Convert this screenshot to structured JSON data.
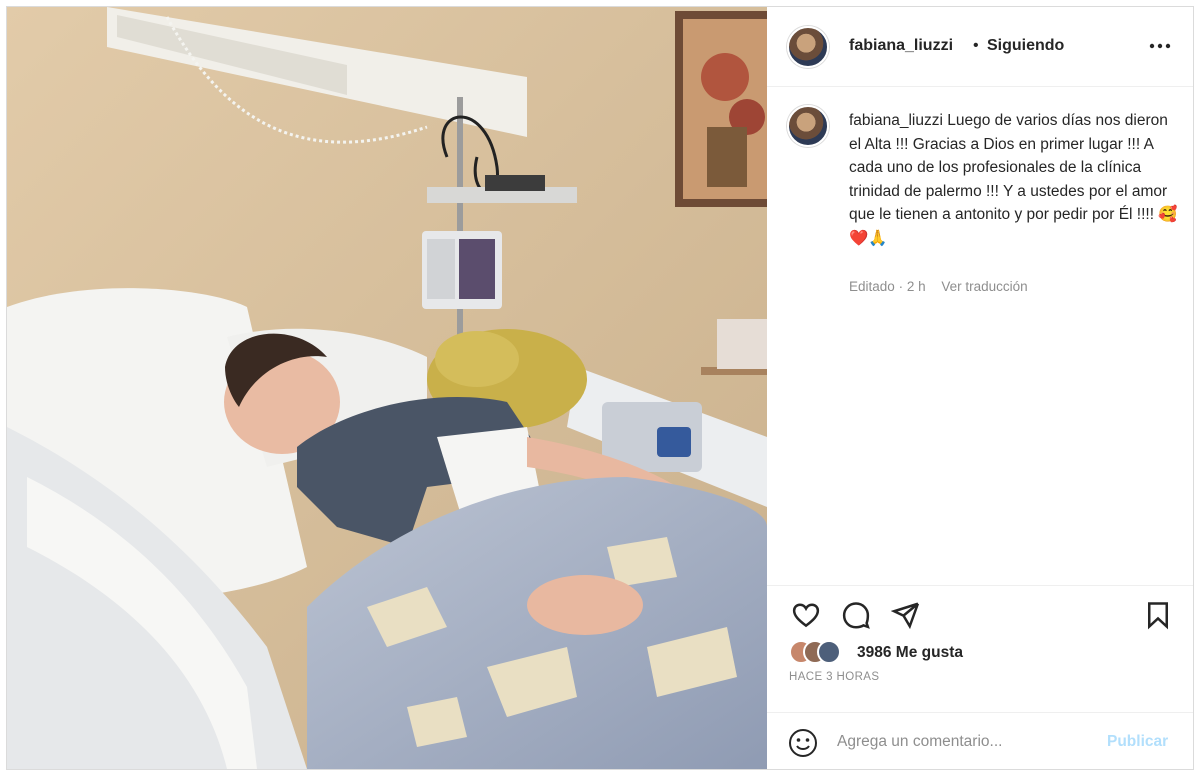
{
  "post": {
    "header": {
      "username": "fabiana_liuzzi",
      "separator": "•",
      "follow_state": "Siguiendo",
      "more_icon": "more-horizontal-icon"
    },
    "photo": {
      "kind": "photograph",
      "palette": {
        "wall": "#d9c2a0",
        "pillow": "#f3f3f1",
        "shirt": "#4a5566",
        "blanket": "#a9b4c9",
        "skin": "#e8b8a0",
        "hair": "#3a2a22",
        "bear": "#c9b04a"
      }
    },
    "caption": {
      "username": "fabiana_liuzzi",
      "text": "Luego de varios días nos dieron el Alta !!! Gracias a Dios en primer lugar !!! A cada uno de los profesionales de la clínica trinidad de palermo !!! Y a ustedes por el amor que le tienen a antonito y por pedir por Él !!!! 🥰❤️🙏",
      "edited_label": "Editado",
      "age": "2 h",
      "translate_label": "Ver traducción"
    },
    "actions": {
      "like_icon": "heart-icon",
      "comment_icon": "comment-icon",
      "share_icon": "paper-plane-icon",
      "save_icon": "bookmark-icon"
    },
    "likes": {
      "count": "3986",
      "label": "Me gusta"
    },
    "timestamp": "HACE 3 HORAS",
    "comment_box": {
      "emoji_icon": "smiley-icon",
      "placeholder": "Agrega un comentario...",
      "publish_label": "Publicar"
    },
    "colors": {
      "text": "#262626",
      "muted": "#8e8e8e",
      "publish_disabled": "#b2dffc",
      "border": "#dbdbdb"
    }
  }
}
